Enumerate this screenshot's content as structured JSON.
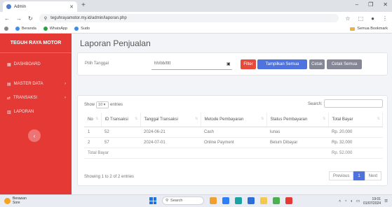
{
  "browser": {
    "tab_title": "Admin",
    "url": "teguhrayamotor.my.id/admin/laporan.php",
    "bookmarks": [
      "Beranda",
      "WhatsApp",
      "Sudo"
    ],
    "bookmarks_right": "Semua Bookmark"
  },
  "sidebar": {
    "brand": "TEGUH RAYA MOTOR",
    "items": [
      {
        "label": "DASHBOARD",
        "icon": "dashboard-icon"
      },
      {
        "label": "MASTER DATA",
        "icon": "folder-icon"
      },
      {
        "label": "TRANSAKSI",
        "icon": "exchange-icon"
      },
      {
        "label": "LAPORAN",
        "icon": "report-icon"
      }
    ]
  },
  "main": {
    "title": "Laporan Penjualan",
    "filter": {
      "label": "Pilih Tanggal",
      "placeholder": "hh/bb/tttt",
      "buttons": {
        "filter": "Filter",
        "show_all": "Tampilkan Semua",
        "print": "Cetak",
        "print_all": "Cetak Semua"
      }
    },
    "table": {
      "show_label": "Show",
      "entries_value": "10",
      "entries_label": "entries",
      "search_label": "Search:",
      "headers": [
        "No",
        "ID Transaksi",
        "Tanggal Transaksi",
        "Metode Pembayaran",
        "Status Pembayaran",
        "Total Bayar"
      ],
      "rows": [
        [
          "1",
          "52",
          "2024-06-21",
          "Cash",
          "lunas",
          "Rp. 20.000"
        ],
        [
          "2",
          "57",
          "2024-07-01",
          "Online Payment",
          "Belum Dibayar",
          "Rp. 32.000"
        ]
      ],
      "footer_label": "Total Bayar",
      "footer_value": "Rp. 52.000",
      "info": "Showing 1 to 2 of 2 entries",
      "pagination": {
        "prev": "Previous",
        "page": "1",
        "next": "Next"
      }
    }
  },
  "taskbar": {
    "weather_temp": "Berawan",
    "weather_desc": "Sore",
    "search": "Search",
    "time": "19:01",
    "date": "01/07/2024"
  },
  "colors": {
    "sidebar": "#e53935",
    "primary": "#4e73df",
    "danger": "#e74a3b",
    "secondary": "#858796"
  }
}
